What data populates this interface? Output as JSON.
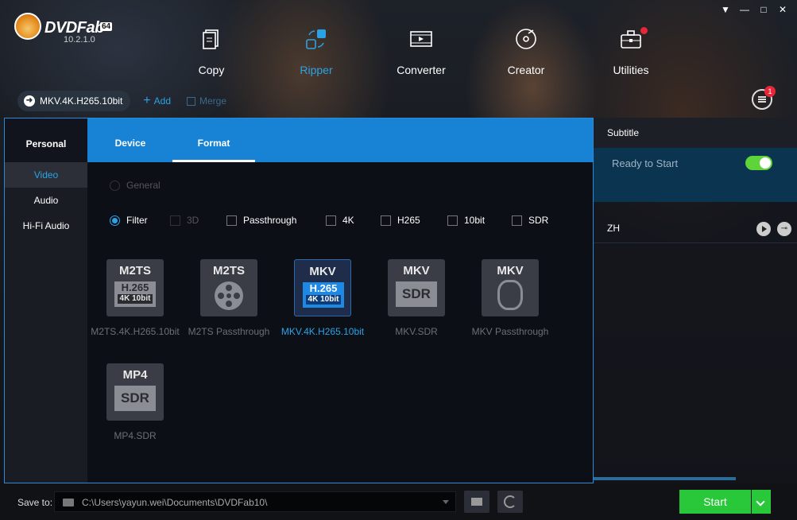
{
  "app": {
    "brand": "DVDFab",
    "bits": "64",
    "version": "10.2.1.0"
  },
  "window_controls": [
    "▼",
    "—",
    "□",
    "✕"
  ],
  "modules": [
    {
      "label": "Copy",
      "icon": "copy-icon"
    },
    {
      "label": "Ripper",
      "icon": "ripper-icon",
      "active": true
    },
    {
      "label": "Converter",
      "icon": "converter-icon"
    },
    {
      "label": "Creator",
      "icon": "creator-icon"
    },
    {
      "label": "Utilities",
      "icon": "utilities-icon",
      "notify": true
    }
  ],
  "profile": {
    "current": "MKV.4K.H265.10bit",
    "add_label": "Add",
    "merge_label": "Merge"
  },
  "queue": {
    "badge": "1"
  },
  "right_panel": {
    "subtitle_header": "Subtitle",
    "ready_text": "Ready to Start",
    "zh_label": "ZH",
    "toggle_on": true
  },
  "dropdown": {
    "tabs": [
      "Personal",
      "Device",
      "Format"
    ],
    "active_tab": "Format",
    "side_items": [
      "Video",
      "Audio",
      "Hi-Fi Audio"
    ],
    "active_side": "Video",
    "general_label": "General",
    "filter_label": "Filter",
    "filters": [
      {
        "label": "3D",
        "disabled": true
      },
      {
        "label": "Passthrough"
      },
      {
        "label": "4K"
      },
      {
        "label": "H265"
      },
      {
        "label": "10bit"
      },
      {
        "label": "SDR"
      }
    ],
    "formats": [
      {
        "top": "M2TS",
        "line1": "H.265",
        "line2": "4K 10bit",
        "label": "M2TS.4K.H265.10bit"
      },
      {
        "top": "M2TS",
        "icon": "film-reel-icon",
        "label": "M2TS Passthrough"
      },
      {
        "top": "MKV",
        "line1": "H.265",
        "line2": "4K 10bit",
        "label": "MKV.4K.H265.10bit",
        "active": true
      },
      {
        "top": "MKV",
        "box": "SDR",
        "label": "MKV.SDR"
      },
      {
        "top": "MKV",
        "icon": "swirl-icon",
        "label": "MKV Passthrough"
      },
      {
        "top": "MP4",
        "box": "SDR",
        "label": "MP4.SDR"
      }
    ]
  },
  "bottom": {
    "save_label": "Save to:",
    "path": "C:\\Users\\yayun.wei\\Documents\\DVDFab10\\",
    "start_label": "Start"
  },
  "colors": {
    "accent": "#2aa3e6",
    "tab_bar": "#1883d5",
    "start": "#28c83a",
    "badge": "#e8263a"
  }
}
